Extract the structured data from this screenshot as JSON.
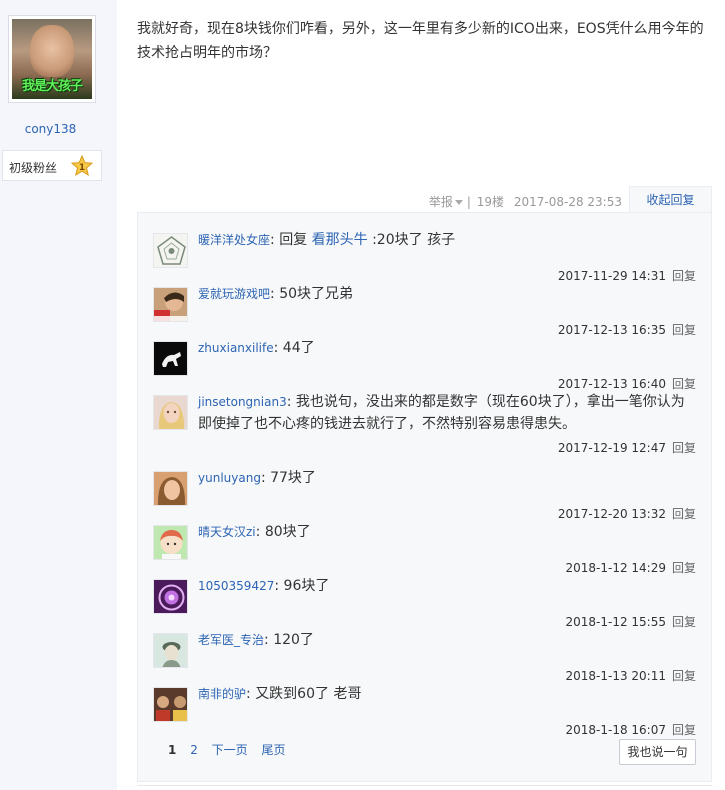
{
  "author": {
    "avatar_caption": "我是大孩子",
    "username": "cony138",
    "rank_label": "初级粉丝",
    "rank_level": "1"
  },
  "post": {
    "content": "我就好奇，现在8块钱你们咋看，另外，这一年里有多少新的ICO出来，EOS凭什么用今年的技术抢占明年的市场？",
    "report": "举报",
    "floor": "19楼",
    "time": "2017-08-28 23:53",
    "collapse_label": "收起回复"
  },
  "replies": [
    {
      "user": "暖洋洋处女座",
      "reply_prefix": "回复 ",
      "reply_to": "看那头牛",
      "text": " :20块了 孩子",
      "time": "2017-11-29 14:31",
      "reply_label": "回复"
    },
    {
      "user": "爱就玩游戏吧",
      "text": "50块了兄弟",
      "time": "2017-12-13 16:35",
      "reply_label": "回复"
    },
    {
      "user": "zhuxianxilife",
      "text": "44了",
      "time": "2017-12-13 16:40",
      "reply_label": "回复"
    },
    {
      "user": "jinsetongnian3",
      "text": "我也说句，没出来的都是数字（现在60块了），拿出一笔你认为即使掉了也不心疼的钱进去就行了，不然特别容易患得患失。",
      "time": "2017-12-19 12:47",
      "reply_label": "回复"
    },
    {
      "user": "yunluyang",
      "text": "77块了",
      "time": "2017-12-20 13:32",
      "reply_label": "回复"
    },
    {
      "user": "晴天女汉zi",
      "text": "80块了",
      "time": "2018-1-12 14:29",
      "reply_label": "回复"
    },
    {
      "user": "1050359427",
      "text": "96块了",
      "time": "2018-1-12 15:55",
      "reply_label": "回复"
    },
    {
      "user": "老军医_专治",
      "text": "120了",
      "time": "2018-1-13 20:11",
      "reply_label": "回复"
    },
    {
      "user": "南非的驴",
      "text": "又跌到60了 老哥",
      "time": "2018-1-18 16:07",
      "reply_label": "回复"
    }
  ],
  "pager": {
    "pages": [
      "1",
      "2"
    ],
    "next": "下一页",
    "last": "尾页"
  },
  "say_button": "我也说一句"
}
